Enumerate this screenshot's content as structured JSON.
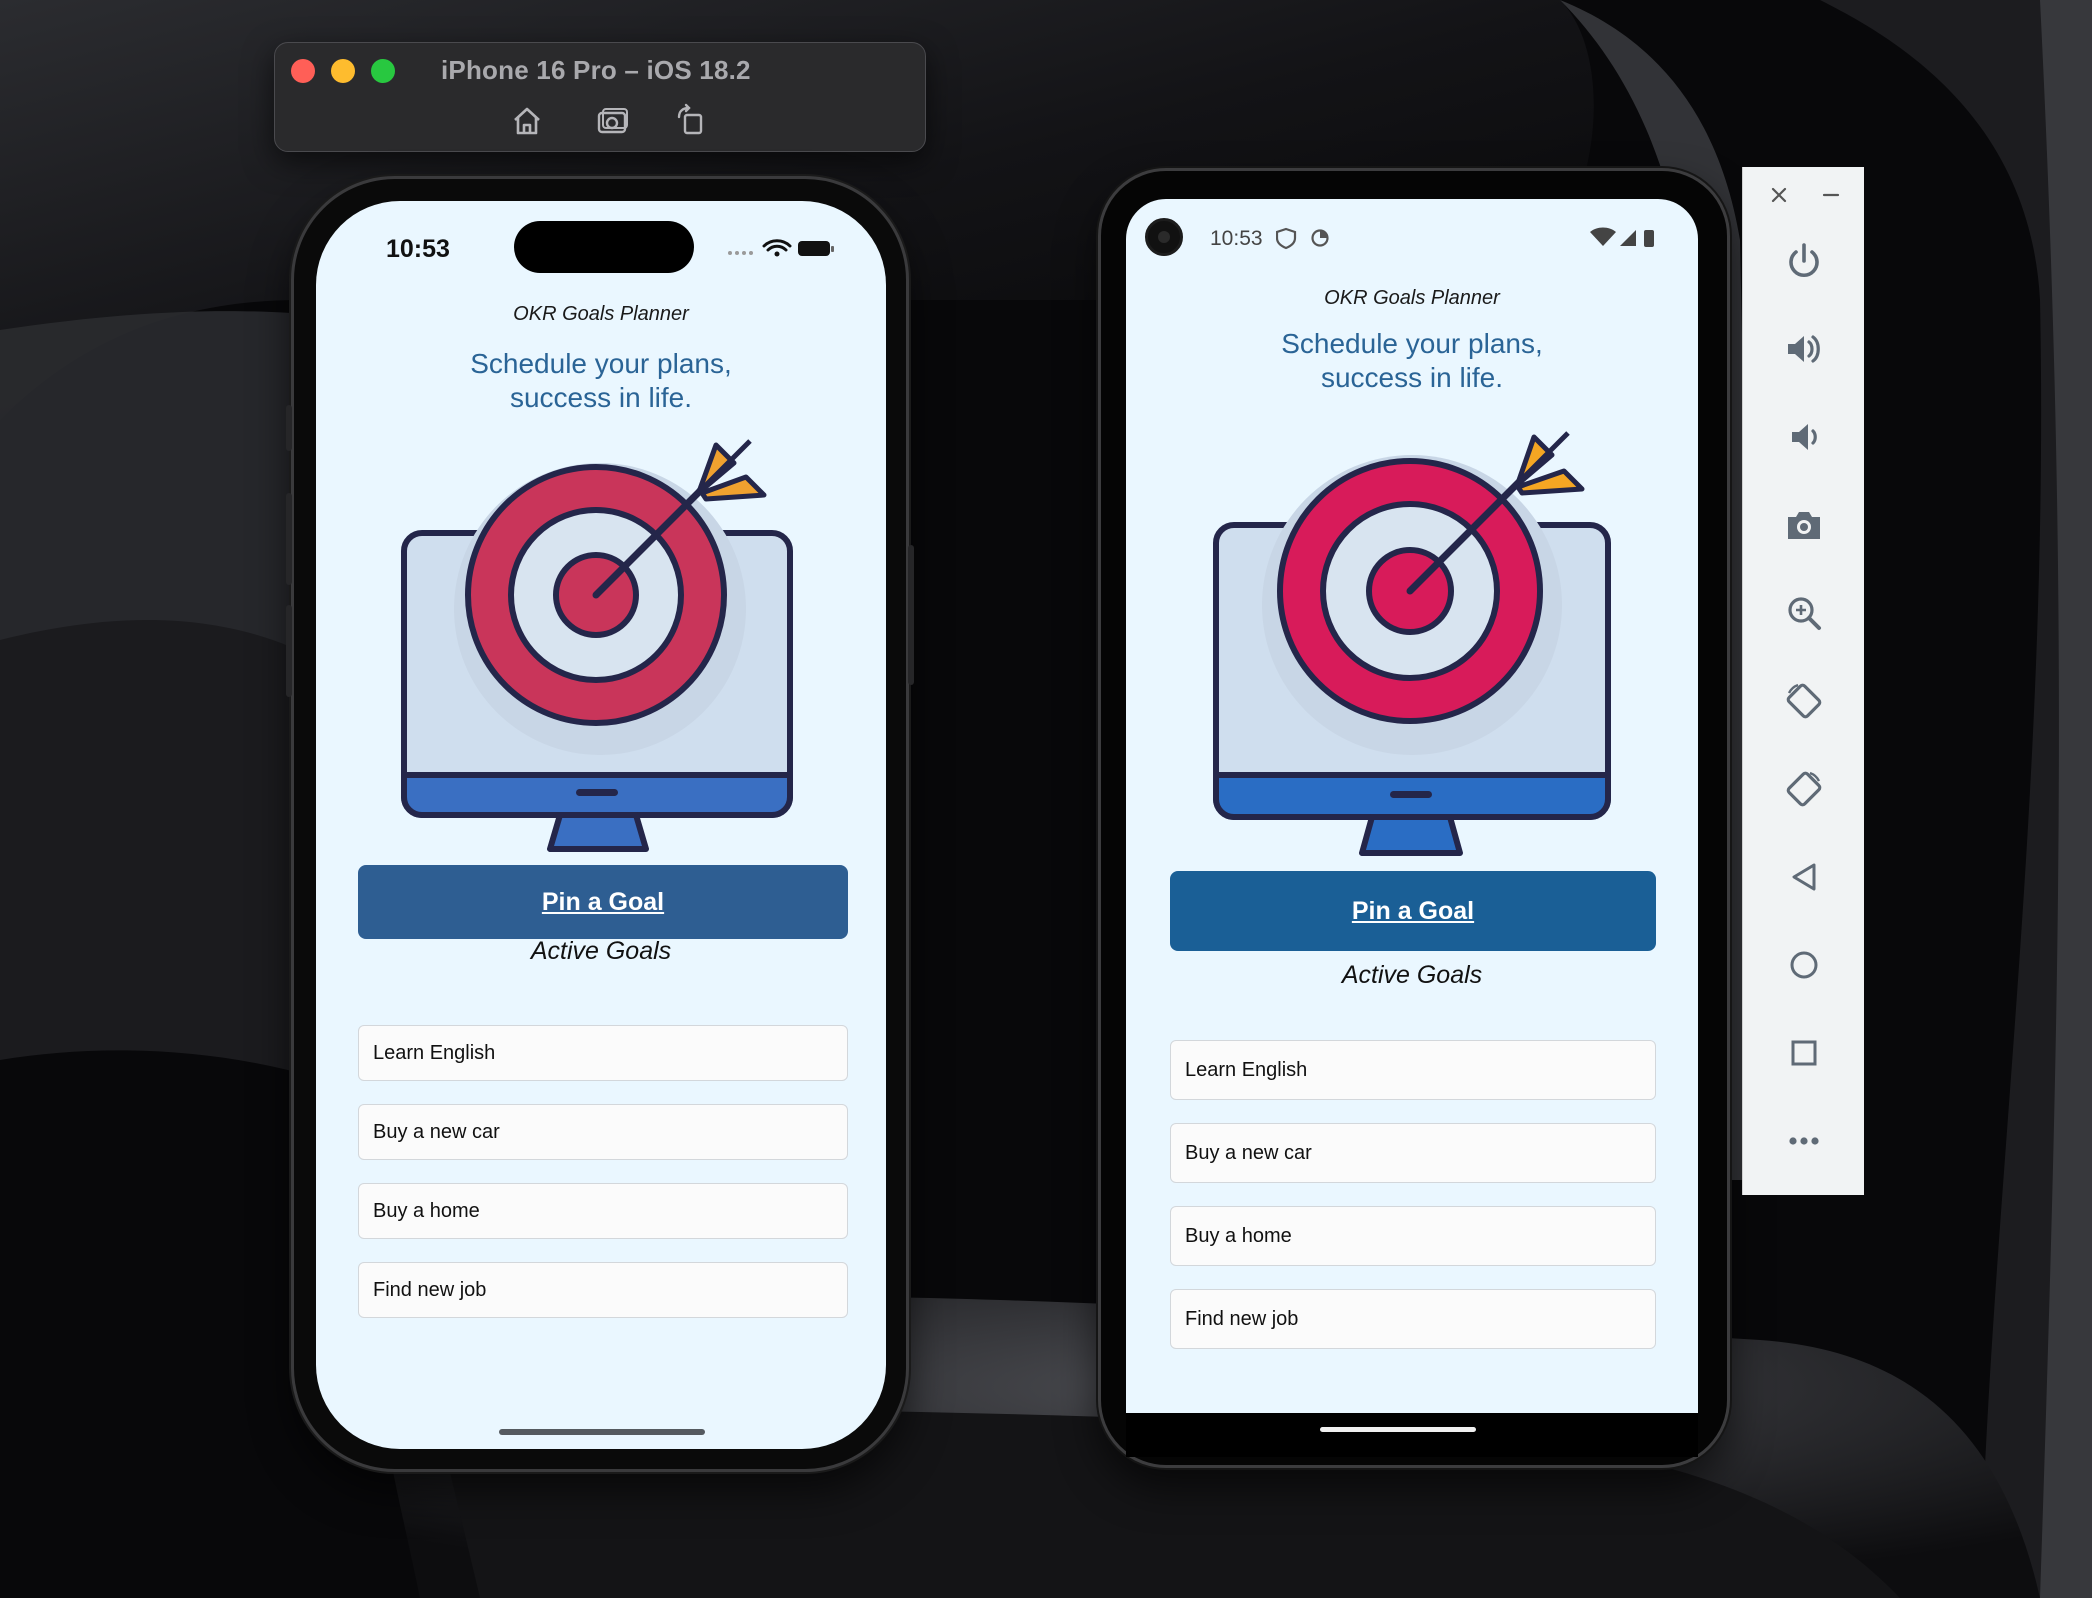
{
  "simulator": {
    "title": "iPhone 16 Pro – iOS 18.2",
    "tools": [
      "home-icon",
      "screenshot-icon",
      "rotate-icon"
    ]
  },
  "ios": {
    "status_time": "10:53",
    "app_title": "OKR Goals Planner",
    "tagline_line1": "Schedule your plans,",
    "tagline_line2": "success in life.",
    "pin_button": "Pin a Goal",
    "active_heading": "Active Goals",
    "goals": [
      "Learn English",
      "Buy a new car",
      "Buy a home",
      "Find new job"
    ]
  },
  "android": {
    "status_time": "10:53",
    "app_title": "OKR Goals Planner",
    "tagline_line1": "Schedule your plans,",
    "tagline_line2": "success in life.",
    "pin_button": "Pin a Goal",
    "active_heading": "Active Goals",
    "goals": [
      "Learn English",
      "Buy a new car",
      "Buy a home",
      "Find new job"
    ]
  },
  "emulator_toolbar": {
    "buttons": [
      "close-icon",
      "minimize-icon",
      "power-icon",
      "volume-up-icon",
      "volume-down-icon",
      "camera-icon",
      "zoom-icon",
      "rotate-left-icon",
      "rotate-right-icon",
      "back-icon",
      "home-icon",
      "overview-icon",
      "more-icon"
    ]
  },
  "colors": {
    "app_background": "#eaf7ff",
    "ios_button": "#2e5e92",
    "android_button": "#1a5f96",
    "tagline": "#2a6496",
    "target_red_ios": "#c9355a",
    "target_red_android": "#d81b5a"
  }
}
